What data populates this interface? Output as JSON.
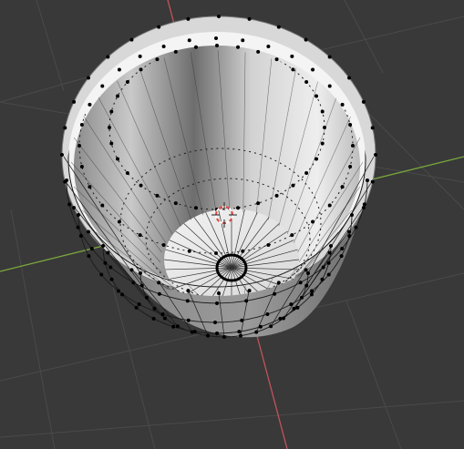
{
  "viewport": {
    "mode": "edit-mode",
    "background": "#393939",
    "colors": {
      "grid": "#4a4a4a",
      "x_axis": "#c2535b",
      "y_axis": "#7aa93c",
      "mesh_light": "#e6e6e6",
      "mesh_mid": "#b9b9b9",
      "mesh_dark": "#6f6f6f",
      "wire": "#1a1a1a",
      "vertex": "#000000",
      "cursor_red": "#e0473f",
      "cursor_white": "#ffffff"
    },
    "mesh": {
      "object": "cup",
      "ring_vertex_counts": [
        32,
        32,
        32,
        32,
        32,
        32
      ]
    },
    "icons": [
      "3d-cursor-icon",
      "object-origin-icon"
    ]
  }
}
